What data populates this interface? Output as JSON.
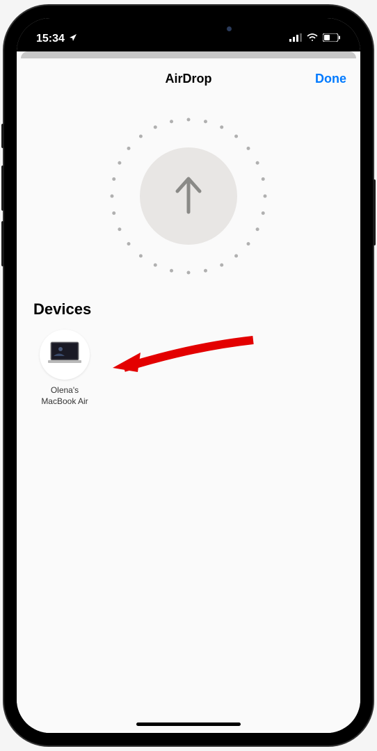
{
  "status": {
    "time": "15:34",
    "location_icon": "◤"
  },
  "sheet": {
    "title": "AirDrop",
    "done_label": "Done",
    "section_label": "Devices"
  },
  "devices": [
    {
      "name": "Olena's\nMacBook Air"
    }
  ]
}
